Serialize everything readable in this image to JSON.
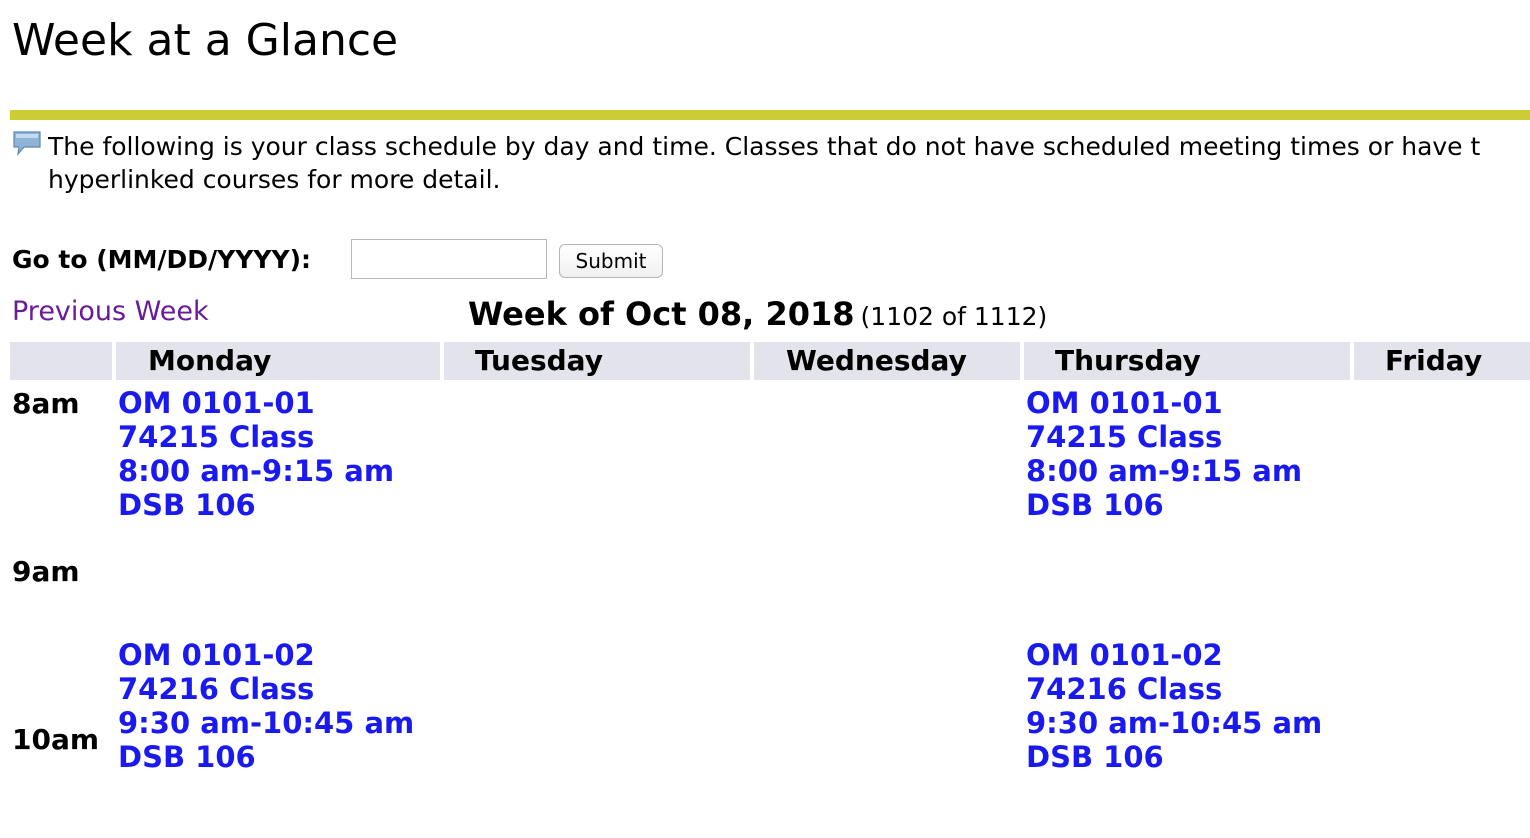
{
  "page": {
    "title": "Week at a Glance",
    "info_line1": "The following is your class schedule by day and time. Classes that do not have scheduled meeting times or have t",
    "info_line2": "hyperlinked courses for more detail."
  },
  "goto": {
    "label": "Go to (MM/DD/YYYY):",
    "input_value": "",
    "input_placeholder": "",
    "submit_label": "Submit"
  },
  "nav": {
    "previous_week_label": "Previous Week",
    "week_of": "Week of Oct 08, 2018",
    "week_count": "(1102 of 1112)"
  },
  "schedule": {
    "days": [
      "Monday",
      "Tuesday",
      "Wednesday",
      "Thursday",
      "Friday"
    ],
    "times": [
      "8am",
      "9am",
      "10am"
    ],
    "classes": {
      "mon_8": {
        "day": "Monday",
        "course": "OM 0101-01",
        "crn": "74215 Class",
        "time": "8:00 am-9:15 am",
        "room": "DSB 106"
      },
      "thu_8": {
        "day": "Thursday",
        "course": "OM 0101-01",
        "crn": "74215 Class",
        "time": "8:00 am-9:15 am",
        "room": "DSB 106"
      },
      "mon_930": {
        "day": "Monday",
        "course": "OM 0101-02",
        "crn": "74216 Class",
        "time": "9:30 am-10:45 am",
        "room": "DSB 106"
      },
      "thu_930": {
        "day": "Thursday",
        "course": "OM 0101-02",
        "crn": "74216 Class",
        "time": "9:30 am-10:45 am",
        "room": "DSB 106"
      }
    }
  },
  "colors": {
    "title_rule": "#cccc33",
    "header_bg": "#e3e3ec",
    "class_link": "#1a1af0",
    "visited_link": "#6a1b9a",
    "icon_fill": "#8fb4d8"
  },
  "icons": {
    "info": "speech-bubble-icon"
  }
}
